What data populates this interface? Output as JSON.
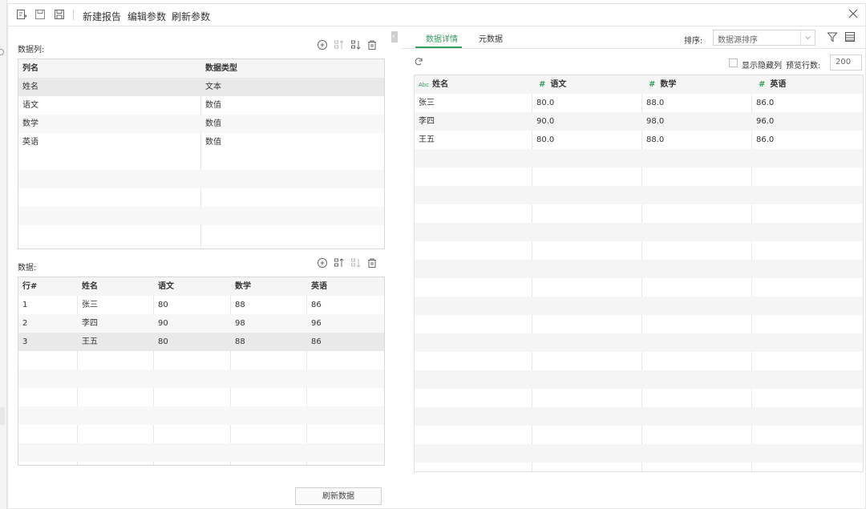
{
  "toolbar": {
    "new_report": "新建报告",
    "edit_params": "编辑参数",
    "refresh_params": "刷新参数"
  },
  "columns_section": {
    "title": "数据列:",
    "headers": [
      "列名",
      "数据类型"
    ],
    "rows": [
      [
        "姓名",
        "文本"
      ],
      [
        "语文",
        "数值"
      ],
      [
        "数学",
        "数值"
      ],
      [
        "英语",
        "数值"
      ]
    ],
    "selected_row": 0
  },
  "data_section": {
    "title": "数据:",
    "headers": [
      "行#",
      "姓名",
      "语文",
      "数学",
      "英语"
    ],
    "rows": [
      [
        "1",
        "张三",
        "80",
        "88",
        "86"
      ],
      [
        "2",
        "李四",
        "90",
        "98",
        "96"
      ],
      [
        "3",
        "王五",
        "80",
        "88",
        "86"
      ]
    ],
    "selected_row": 2,
    "refresh_button": "刷新数据"
  },
  "right_panel": {
    "tabs": [
      {
        "label": "数据详情",
        "active": true
      },
      {
        "label": "元数据",
        "active": false
      }
    ],
    "sort_label": "排序:",
    "sort_value": "数据源排序",
    "show_hidden_label": "显示隐藏列",
    "preview_label": "预览行数:",
    "preview_value": "200",
    "headers": [
      {
        "type": "Abc",
        "label": "姓名"
      },
      {
        "type": "#",
        "label": "语文"
      },
      {
        "type": "#",
        "label": "数学"
      },
      {
        "type": "#",
        "label": "英语"
      }
    ],
    "rows": [
      [
        "张三",
        "80.0",
        "88.0",
        "86.0"
      ],
      [
        "李四",
        "90.0",
        "98.0",
        "96.0"
      ],
      [
        "王五",
        "80.0",
        "88.0",
        "86.0"
      ]
    ]
  },
  "colors": {
    "accent": "#2f9d5b",
    "stripe": "#f5f5f5",
    "selected": "#e9e9e9"
  }
}
